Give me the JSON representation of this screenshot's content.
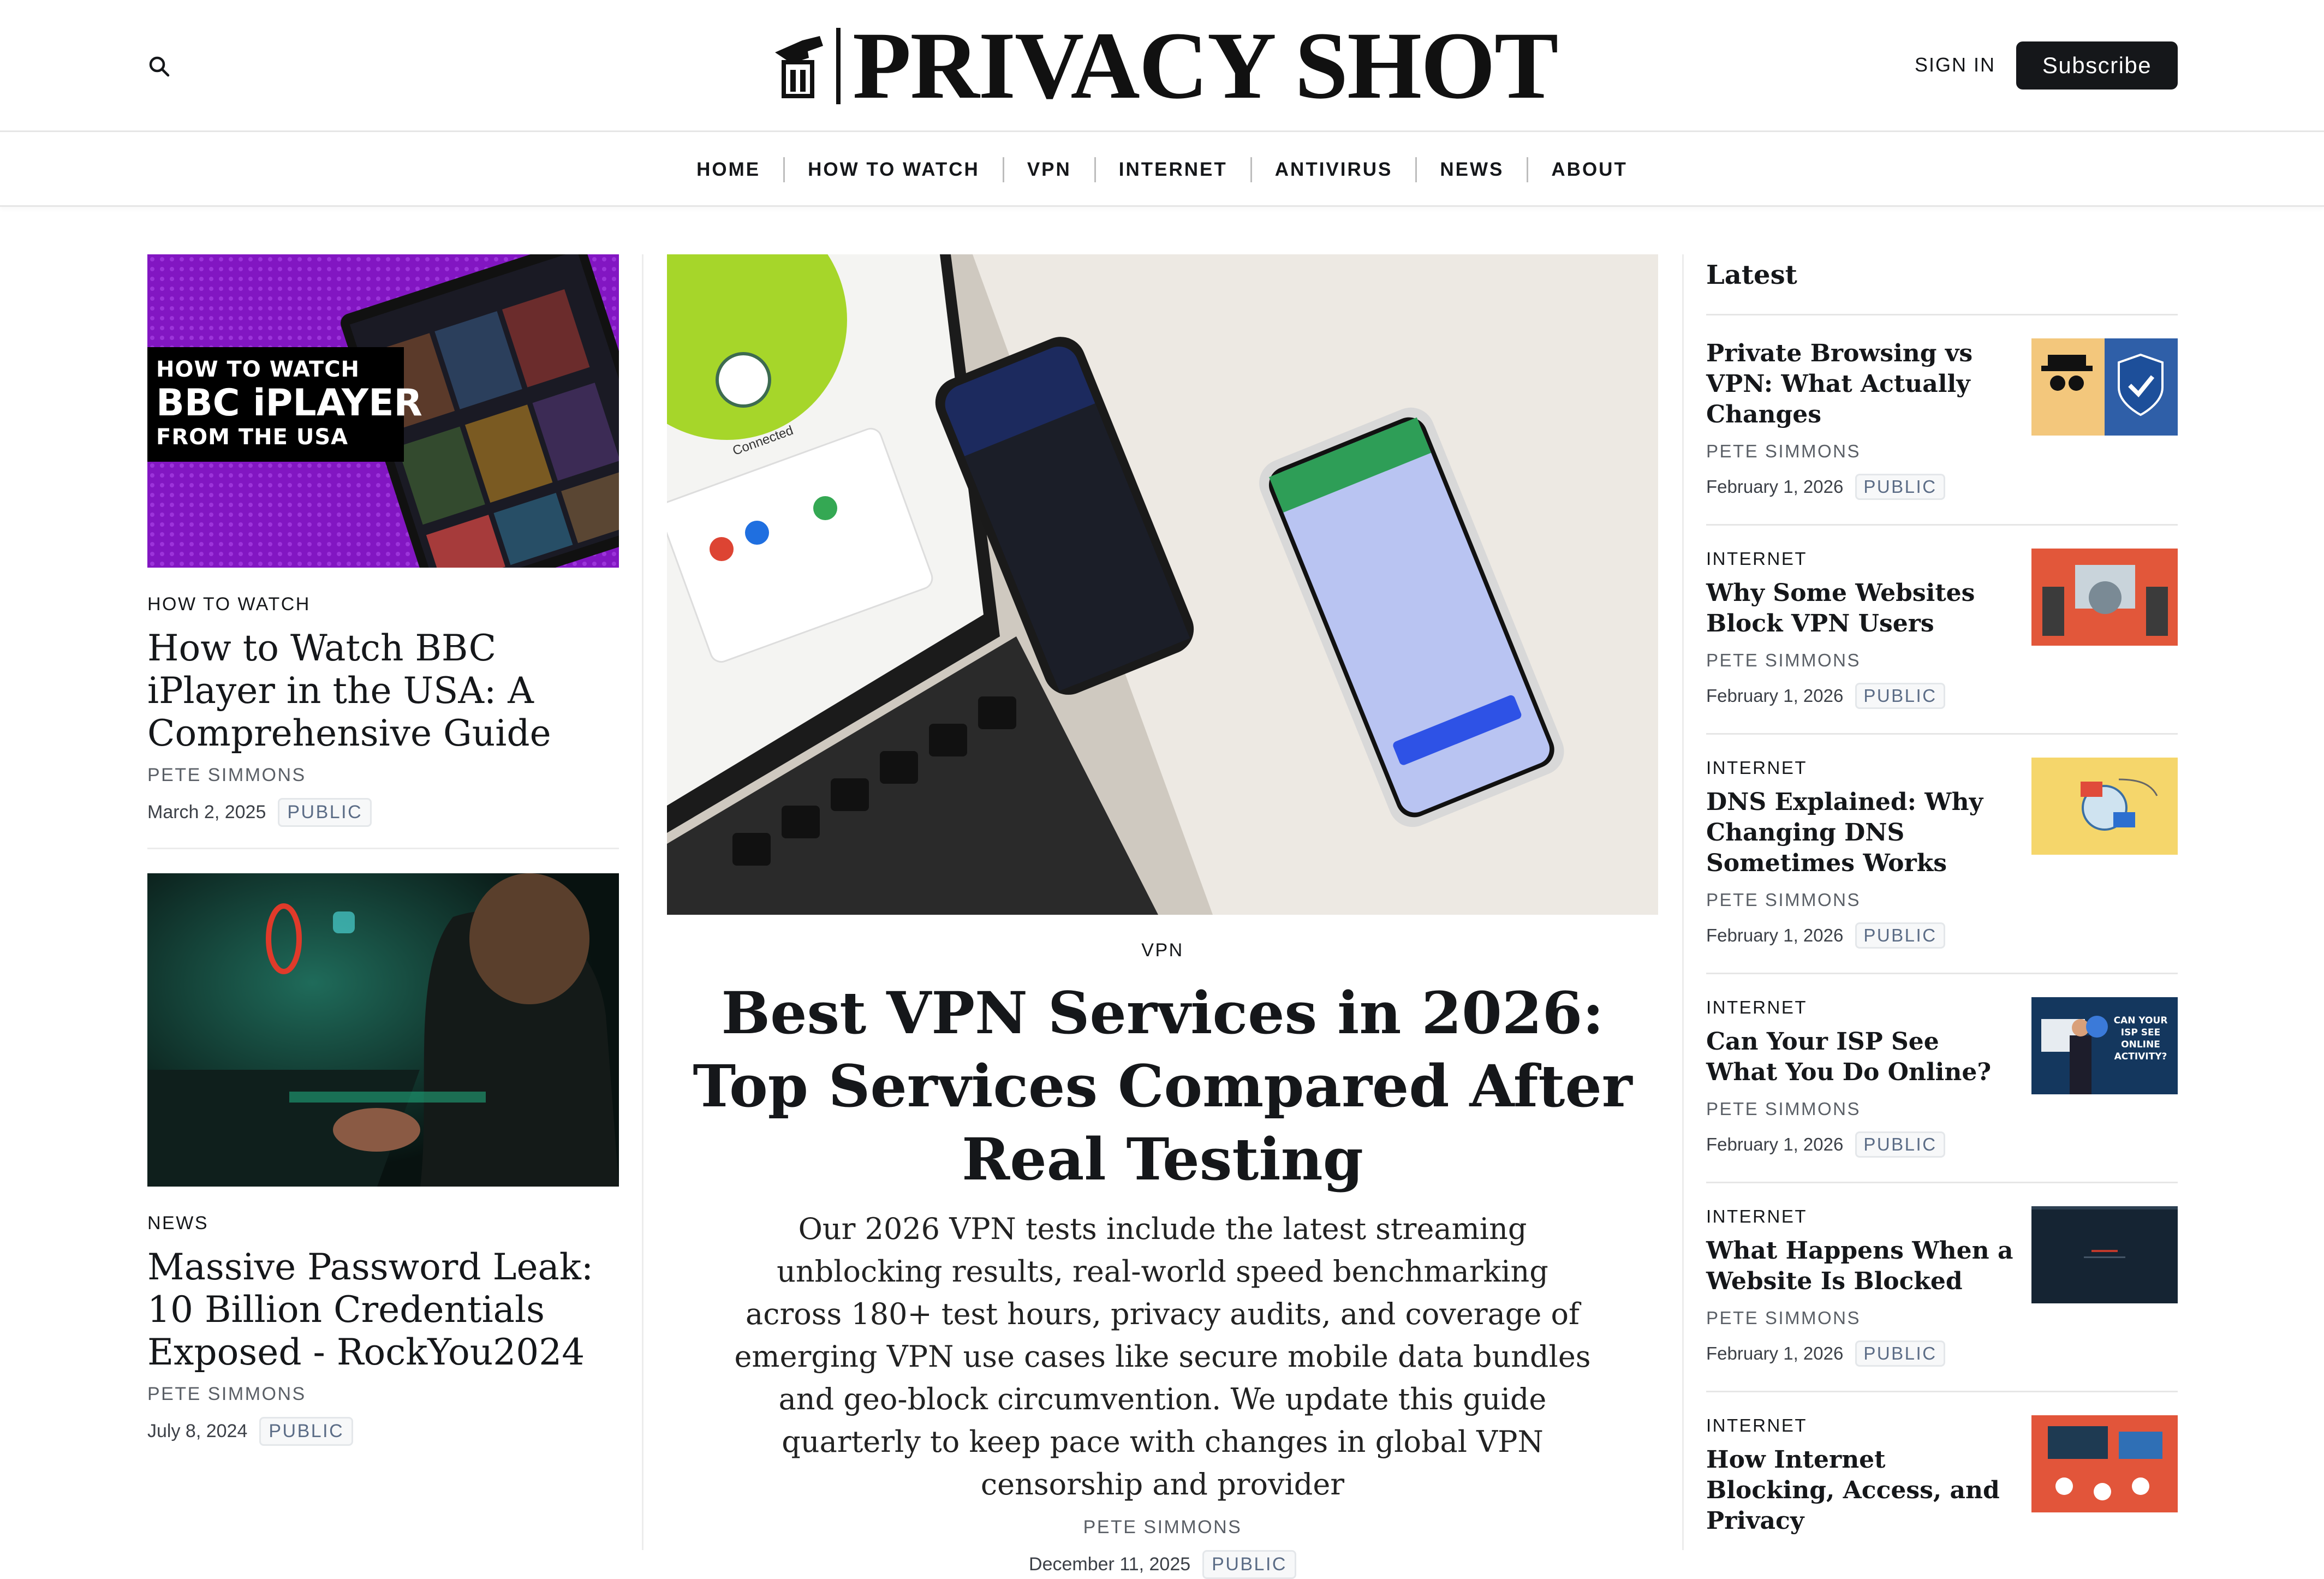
{
  "header": {
    "site_name": "PRIVACY SHOT",
    "signin_label": "SIGN IN",
    "subscribe_label": "Subscribe"
  },
  "nav": {
    "items": [
      "HOME",
      "HOW TO WATCH",
      "VPN",
      "INTERNET",
      "ANTIVIRUS",
      "NEWS",
      "ABOUT"
    ]
  },
  "left_posts": [
    {
      "thumb_text": [
        "HOW TO WATCH",
        "BBC iPLAYER",
        "FROM THE USA"
      ],
      "category": "HOW TO WATCH",
      "title": "How to Watch BBC iPlayer in the USA: A Comprehensive Guide",
      "author": "PETE SIMMONS",
      "date": "March 2, 2025",
      "badge": "PUBLIC"
    },
    {
      "category": "NEWS",
      "title": "Massive Password Leak: 10 Billion Credentials Exposed - RockYou2024",
      "author": "PETE SIMMONS",
      "date": "July 8, 2024",
      "badge": "PUBLIC"
    }
  ],
  "featured": {
    "category": "VPN",
    "title": "Best VPN Services in 2026: Top Services Compared After Real Testing",
    "excerpt": "Our 2026 VPN tests include the latest streaming unblocking results, real-world speed benchmarking across 180+ test hours, privacy audits, and coverage of emerging VPN use cases like secure mobile data bundles and geo-block circumvention. We update this guide quarterly to keep pace with changes in global VPN censorship and provider",
    "author": "PETE SIMMONS",
    "date": "December 11, 2025",
    "badge": "PUBLIC",
    "image_text": {
      "connected": "Connected"
    }
  },
  "latest": {
    "heading": "Latest",
    "items": [
      {
        "category": "",
        "title": "Private Browsing vs VPN: What Actually Changes",
        "author": "PETE SIMMONS",
        "date": "February 1, 2026",
        "badge": "PUBLIC"
      },
      {
        "category": "INTERNET",
        "title": "Why Some Websites Block VPN Users",
        "author": "PETE SIMMONS",
        "date": "February 1, 2026",
        "badge": "PUBLIC"
      },
      {
        "category": "INTERNET",
        "title": "DNS Explained: Why Changing DNS Sometimes Works",
        "author": "PETE SIMMONS",
        "date": "February 1, 2026",
        "badge": "PUBLIC"
      },
      {
        "category": "INTERNET",
        "title": "Can Your ISP See What You Do Online?",
        "author": "PETE SIMMONS",
        "date": "February 1, 2026",
        "badge": "PUBLIC",
        "thumb_text": "CAN YOUR ISP SEE ONLINE ACTIVITY?"
      },
      {
        "category": "INTERNET",
        "title": "What Happens When a Website Is Blocked",
        "author": "PETE SIMMONS",
        "date": "February 1, 2026",
        "badge": "PUBLIC"
      },
      {
        "category": "INTERNET",
        "title": "How Internet Blocking, Access, and Privacy",
        "author": "",
        "date": "",
        "badge": ""
      }
    ]
  },
  "colors": {
    "text": "#15171a",
    "subscribe_bg": "#15171a",
    "badge_text": "#5b6c86",
    "bbc_purple": "#8a1fc4",
    "vpn_green": "#7ed321"
  },
  "icons": {
    "search": "search-icon",
    "logo": "camera-shot-logo-icon"
  }
}
